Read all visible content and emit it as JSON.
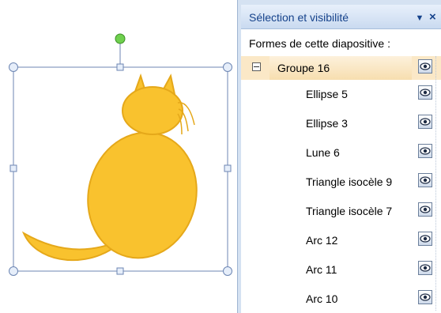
{
  "canvas": {
    "shape_fill": "#f9c22e",
    "shape_stroke": "#e5a81a",
    "selection_color": "#6d86b3",
    "rotate_handle_color": "#6fd04e"
  },
  "pane": {
    "title": "Sélection et visibilité",
    "menu_icon": "chevron-down-icon",
    "close_icon": "close-icon",
    "shapes_label": "Formes de cette diapositive :",
    "items": [
      {
        "label": "Groupe 16",
        "is_group": true,
        "visible": true
      },
      {
        "label": "Ellipse 5",
        "visible": true
      },
      {
        "label": "Ellipse 3",
        "visible": true
      },
      {
        "label": "Lune 6",
        "visible": true
      },
      {
        "label": "Triangle isocèle 9",
        "visible": true
      },
      {
        "label": "Triangle isocèle 7",
        "visible": true
      },
      {
        "label": "Arc 12",
        "visible": true
      },
      {
        "label": "Arc 11",
        "visible": true
      },
      {
        "label": "Arc 10",
        "visible": true
      }
    ],
    "header_color": "#15428b",
    "group_highlight": "#f7deaf"
  }
}
